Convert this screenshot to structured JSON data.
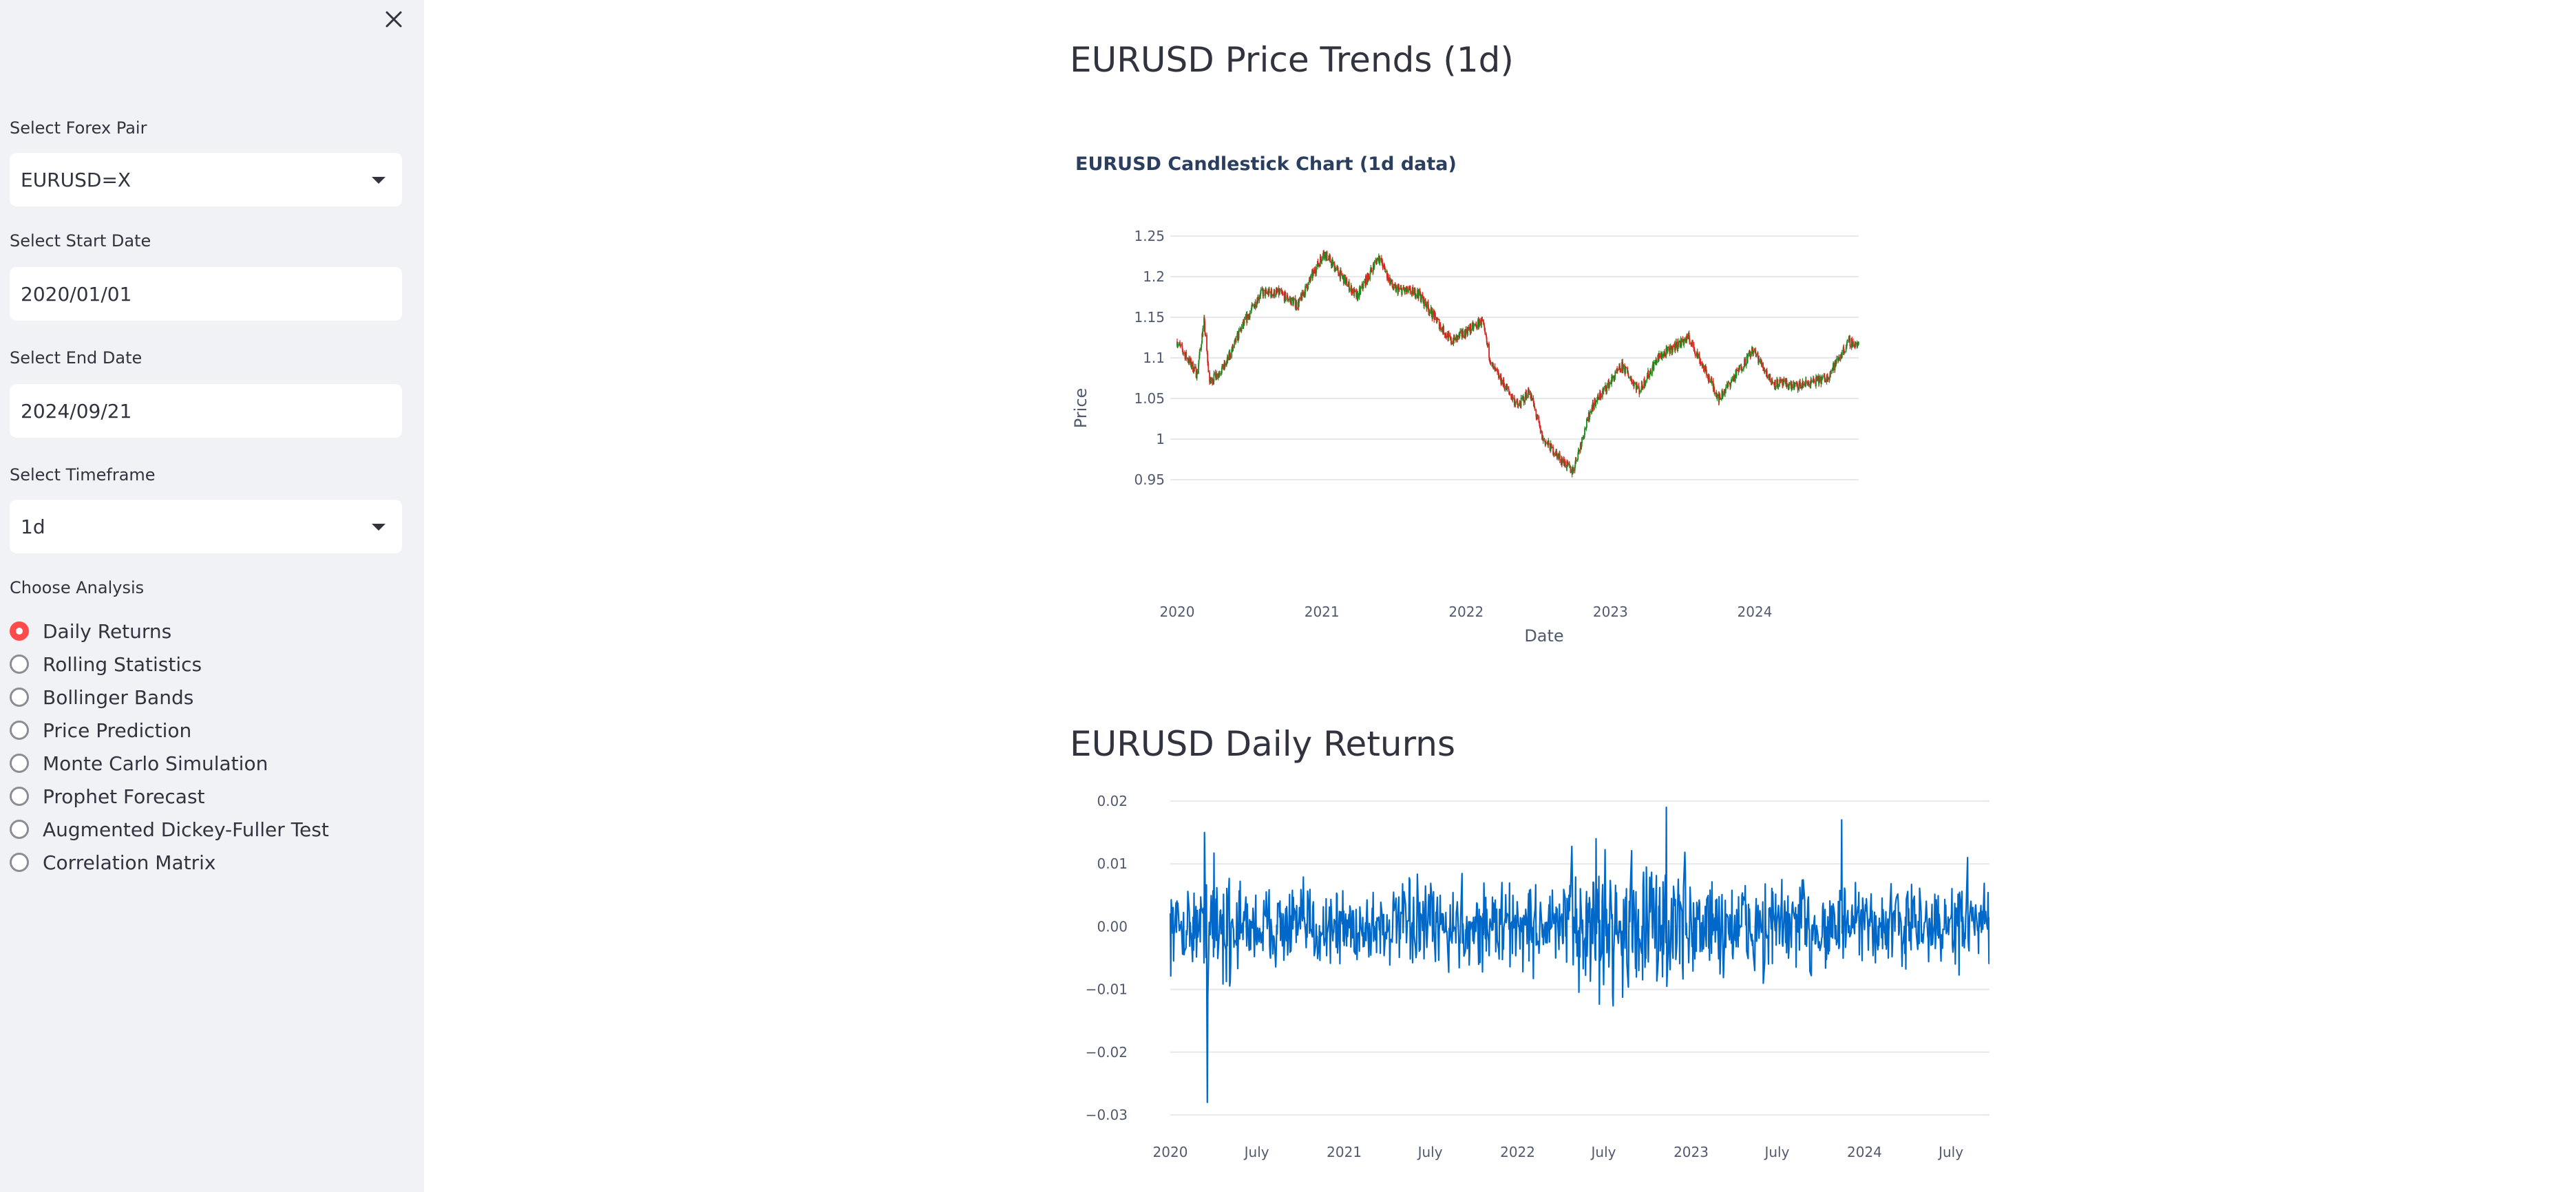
{
  "sidebar": {
    "forex_label": "Select Forex Pair",
    "forex_value": "EURUSD=X",
    "start_label": "Select Start Date",
    "start_value": "2020/01/01",
    "end_label": "Select End Date",
    "end_value": "2024/09/21",
    "timeframe_label": "Select Timeframe",
    "timeframe_value": "1d",
    "analysis_label": "Choose Analysis",
    "analysis_options": [
      "Daily Returns",
      "Rolling Statistics",
      "Bollinger Bands",
      "Price Prediction",
      "Monte Carlo Simulation",
      "Prophet Forecast",
      "Augmented Dickey-Fuller Test",
      "Correlation Matrix"
    ],
    "selected_index": 0
  },
  "main": {
    "price_heading": "EURUSD Price Trends (1d)",
    "returns_heading": "EURUSD Daily Returns"
  },
  "colors": {
    "accent": "#ff4b4b",
    "sidebar_bg": "#f0f2f6",
    "up": "#1f8a1f",
    "down": "#e0201c",
    "returns_line": "#0068c9",
    "grid": "#e6e8ee"
  },
  "chart_data": [
    {
      "type": "candlestick",
      "title": "EURUSD Candlestick Chart (1d data)",
      "xlabel": "Date",
      "ylabel": "Price",
      "x_ticks": [
        "2020",
        "2021",
        "2022",
        "2023",
        "2024"
      ],
      "y_ticks": [
        "0.95",
        "1",
        "1.05",
        "1.1",
        "1.15",
        "1.2",
        "1.25"
      ],
      "xlim": [
        "2020-01-01",
        "2024-09-20"
      ],
      "ylim": [
        0.95,
        1.25
      ],
      "grid": true,
      "approx_close_series": [
        {
          "date": "2020-01-01",
          "close": 1.12
        },
        {
          "date": "2020-02-20",
          "close": 1.08
        },
        {
          "date": "2020-03-09",
          "close": 1.145
        },
        {
          "date": "2020-03-23",
          "close": 1.07
        },
        {
          "date": "2020-05-01",
          "close": 1.09
        },
        {
          "date": "2020-06-10",
          "close": 1.135
        },
        {
          "date": "2020-07-30",
          "close": 1.18
        },
        {
          "date": "2020-09-15",
          "close": 1.18
        },
        {
          "date": "2020-11-01",
          "close": 1.165
        },
        {
          "date": "2021-01-06",
          "close": 1.23
        },
        {
          "date": "2021-03-31",
          "close": 1.175
        },
        {
          "date": "2021-05-25",
          "close": 1.225
        },
        {
          "date": "2021-07-01",
          "close": 1.185
        },
        {
          "date": "2021-09-01",
          "close": 1.18
        },
        {
          "date": "2021-11-24",
          "close": 1.12
        },
        {
          "date": "2022-02-10",
          "close": 1.145
        },
        {
          "date": "2022-03-07",
          "close": 1.09
        },
        {
          "date": "2022-05-13",
          "close": 1.04
        },
        {
          "date": "2022-06-10",
          "close": 1.06
        },
        {
          "date": "2022-07-14",
          "close": 1.0
        },
        {
          "date": "2022-09-27",
          "close": 0.96
        },
        {
          "date": "2022-11-15",
          "close": 1.04
        },
        {
          "date": "2023-01-31",
          "close": 1.09
        },
        {
          "date": "2023-03-15",
          "close": 1.06
        },
        {
          "date": "2023-05-01",
          "close": 1.1
        },
        {
          "date": "2023-07-18",
          "close": 1.125
        },
        {
          "date": "2023-10-03",
          "close": 1.05
        },
        {
          "date": "2023-12-28",
          "close": 1.11
        },
        {
          "date": "2024-02-14",
          "close": 1.07
        },
        {
          "date": "2024-04-16",
          "close": 1.065
        },
        {
          "date": "2024-07-01",
          "close": 1.075
        },
        {
          "date": "2024-08-26",
          "close": 1.12
        },
        {
          "date": "2024-09-20",
          "close": 1.115
        }
      ]
    },
    {
      "type": "line",
      "title": "",
      "xlabel": "",
      "ylabel": "",
      "x_ticks": [
        "2020",
        "July",
        "2021",
        "July",
        "2022",
        "July",
        "2023",
        "July",
        "2024",
        "July"
      ],
      "y_ticks": [
        "−0.03",
        "−0.02",
        "−0.01",
        "0.00",
        "0.01",
        "0.02"
      ],
      "xlim": [
        "2020-01-01",
        "2024-09-20"
      ],
      "ylim": [
        -0.03,
        0.02
      ],
      "grid": true,
      "notable_points": [
        {
          "date": "2020-03-19",
          "value": -0.028
        },
        {
          "date": "2020-03-13",
          "value": 0.015
        },
        {
          "date": "2022-06-15",
          "value": 0.014
        },
        {
          "date": "2022-11-10",
          "value": 0.019
        },
        {
          "date": "2023-11-14",
          "value": 0.017
        },
        {
          "date": "2024-08-05",
          "value": 0.011
        }
      ]
    }
  ]
}
